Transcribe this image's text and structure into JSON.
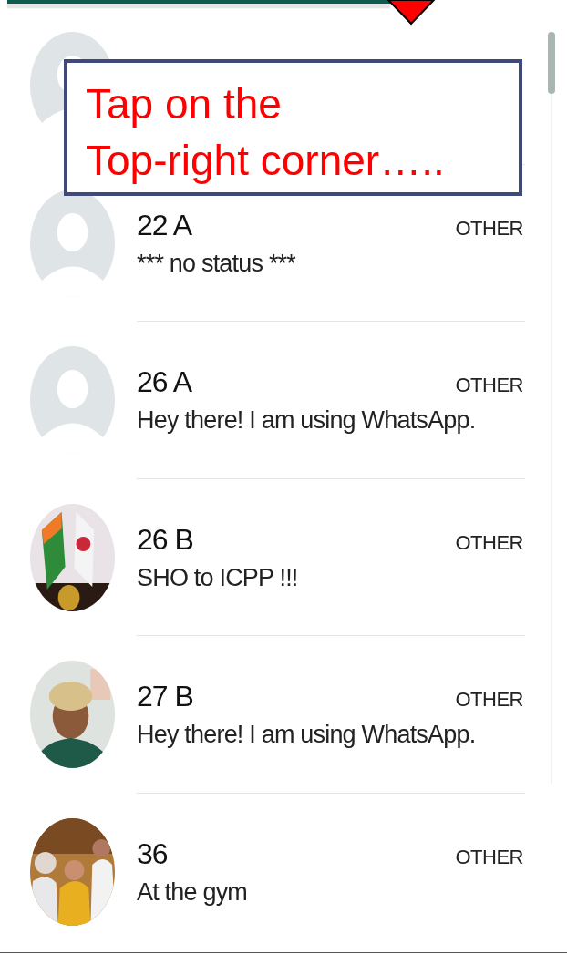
{
  "annotation": {
    "text": "Tap on the\nTop-right corner….."
  },
  "contacts": [
    {
      "kind": "placeholder"
    },
    {
      "kind": "placeholder",
      "name": "22 A",
      "label": "OTHER",
      "status": "*** no status ***"
    },
    {
      "kind": "placeholder",
      "name": "26 A",
      "label": "OTHER",
      "status": "Hey there! I am using WhatsApp."
    },
    {
      "kind": "picture",
      "name": "26 B",
      "label": "OTHER",
      "status": "SHO to ICPP !!!"
    },
    {
      "kind": "picture",
      "name": "27 B",
      "label": "OTHER",
      "status": "Hey there! I am using WhatsApp."
    },
    {
      "kind": "picture",
      "name": "36",
      "label": "OTHER",
      "status": "At the gym"
    }
  ]
}
